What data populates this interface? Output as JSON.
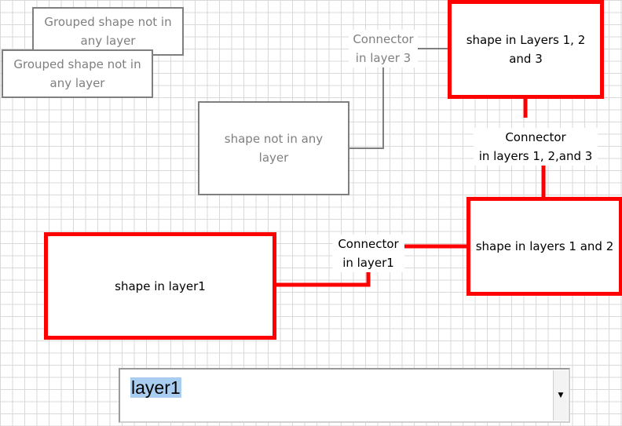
{
  "diagram": {
    "shapes": [
      {
        "id": "grouped-1",
        "label": "Grouped shape not in any layer",
        "style": "gray"
      },
      {
        "id": "grouped-2",
        "label": "Grouped shape not in any layer",
        "style": "gray"
      },
      {
        "id": "not-in-layer",
        "label": "shape not in any layer",
        "style": "gray"
      },
      {
        "id": "layers-123",
        "label": "shape in Layers 1, 2 and 3",
        "style": "red"
      },
      {
        "id": "layers-12",
        "label": "shape in layers 1 and 2",
        "style": "red"
      },
      {
        "id": "layer-1",
        "label": "shape in layer1",
        "style": "red"
      }
    ],
    "connectors": [
      {
        "id": "conn-layer3",
        "label_line1": "Connector",
        "label_line2": "in layer 3"
      },
      {
        "id": "conn-layers123",
        "label_line1": "Connector",
        "label_line2": "in layers 1, 2,and 3"
      },
      {
        "id": "conn-layer1",
        "label_line1": "Connector",
        "label_line2": "in layer1"
      }
    ]
  },
  "layer_selector": {
    "selected_value": "layer1",
    "arrow_glyph": "▼"
  },
  "colors": {
    "layer_highlight": "#ff0000",
    "unlayered": "#7f7f7f",
    "grid": "#d9d9d9",
    "selection": "#a8cdf0"
  }
}
